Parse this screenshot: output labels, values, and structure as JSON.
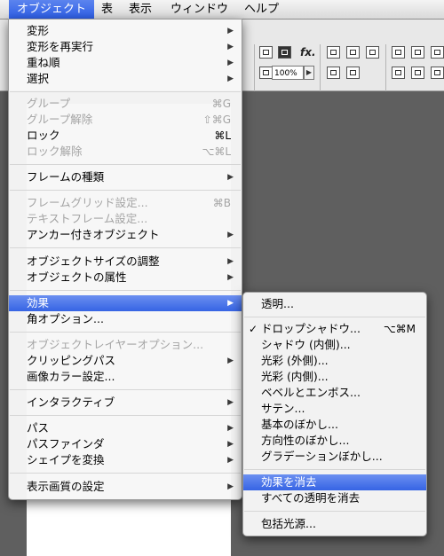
{
  "menubar": {
    "items": [
      "オブジェクト",
      "表",
      "表示",
      "ウィンドウ",
      "ヘルプ"
    ]
  },
  "toolbar": {
    "fx_label": "fx.",
    "opacity_value": "100%"
  },
  "main_menu": {
    "items": [
      {
        "label": "変形",
        "shortcut": "",
        "submenu": true,
        "disabled": false
      },
      {
        "label": "変形を再実行",
        "shortcut": "",
        "submenu": true,
        "disabled": false
      },
      {
        "label": "重ね順",
        "shortcut": "",
        "submenu": true,
        "disabled": false
      },
      {
        "label": "選択",
        "shortcut": "",
        "submenu": true,
        "disabled": false
      },
      {
        "label": "グループ",
        "shortcut": "⌘G",
        "submenu": false,
        "disabled": true
      },
      {
        "label": "グループ解除",
        "shortcut": "⇧⌘G",
        "submenu": false,
        "disabled": true
      },
      {
        "label": "ロック",
        "shortcut": "⌘L",
        "submenu": false,
        "disabled": false
      },
      {
        "label": "ロック解除",
        "shortcut": "⌥⌘L",
        "submenu": false,
        "disabled": true
      },
      {
        "label": "フレームの種類",
        "shortcut": "",
        "submenu": true,
        "disabled": false
      },
      {
        "label": "フレームグリッド設定...",
        "shortcut": "⌘B",
        "submenu": false,
        "disabled": true
      },
      {
        "label": "テキストフレーム設定...",
        "shortcut": "",
        "submenu": false,
        "disabled": true
      },
      {
        "label": "アンカー付きオブジェクト",
        "shortcut": "",
        "submenu": true,
        "disabled": false
      },
      {
        "label": "オブジェクトサイズの調整",
        "shortcut": "",
        "submenu": true,
        "disabled": false
      },
      {
        "label": "オブジェクトの属性",
        "shortcut": "",
        "submenu": true,
        "disabled": false
      },
      {
        "label": "効果",
        "shortcut": "",
        "submenu": true,
        "disabled": false
      },
      {
        "label": "角オプション...",
        "shortcut": "",
        "submenu": false,
        "disabled": false
      },
      {
        "label": "オブジェクトレイヤーオプション...",
        "shortcut": "",
        "submenu": false,
        "disabled": true
      },
      {
        "label": "クリッピングパス",
        "shortcut": "",
        "submenu": true,
        "disabled": false
      },
      {
        "label": "画像カラー設定...",
        "shortcut": "",
        "submenu": false,
        "disabled": false
      },
      {
        "label": "インタラクティブ",
        "shortcut": "",
        "submenu": true,
        "disabled": false
      },
      {
        "label": "パス",
        "shortcut": "",
        "submenu": true,
        "disabled": false
      },
      {
        "label": "パスファインダ",
        "shortcut": "",
        "submenu": true,
        "disabled": false
      },
      {
        "label": "シェイプを変換",
        "shortcut": "",
        "submenu": true,
        "disabled": false
      },
      {
        "label": "表示画質の設定",
        "shortcut": "",
        "submenu": true,
        "disabled": false
      }
    ]
  },
  "effects_submenu": {
    "items": [
      {
        "label": "透明...",
        "shortcut": "",
        "checked": false
      },
      {
        "label": "ドロップシャドウ...",
        "shortcut": "⌥⌘M",
        "checked": true
      },
      {
        "label": "シャドウ (内側)...",
        "shortcut": "",
        "checked": false
      },
      {
        "label": "光彩 (外側)...",
        "shortcut": "",
        "checked": false
      },
      {
        "label": "光彩 (内側)...",
        "shortcut": "",
        "checked": false
      },
      {
        "label": "ベベルとエンボス...",
        "shortcut": "",
        "checked": false
      },
      {
        "label": "サテン...",
        "shortcut": "",
        "checked": false
      },
      {
        "label": "基本のぼかし...",
        "shortcut": "",
        "checked": false
      },
      {
        "label": "方向性のぼかし...",
        "shortcut": "",
        "checked": false
      },
      {
        "label": "グラデーションぼかし...",
        "shortcut": "",
        "checked": false
      },
      {
        "label": "効果を消去",
        "shortcut": "",
        "checked": false
      },
      {
        "label": "すべての透明を消去",
        "shortcut": "",
        "checked": false
      },
      {
        "label": "包括光源...",
        "shortcut": "",
        "checked": false
      }
    ],
    "checkmark": "✓"
  },
  "submenu_arrow": "▶",
  "colors": {
    "highlight": "#3664e4",
    "disabled_text": "#a4a4a4",
    "menu_bg": "#f7f7f7"
  }
}
